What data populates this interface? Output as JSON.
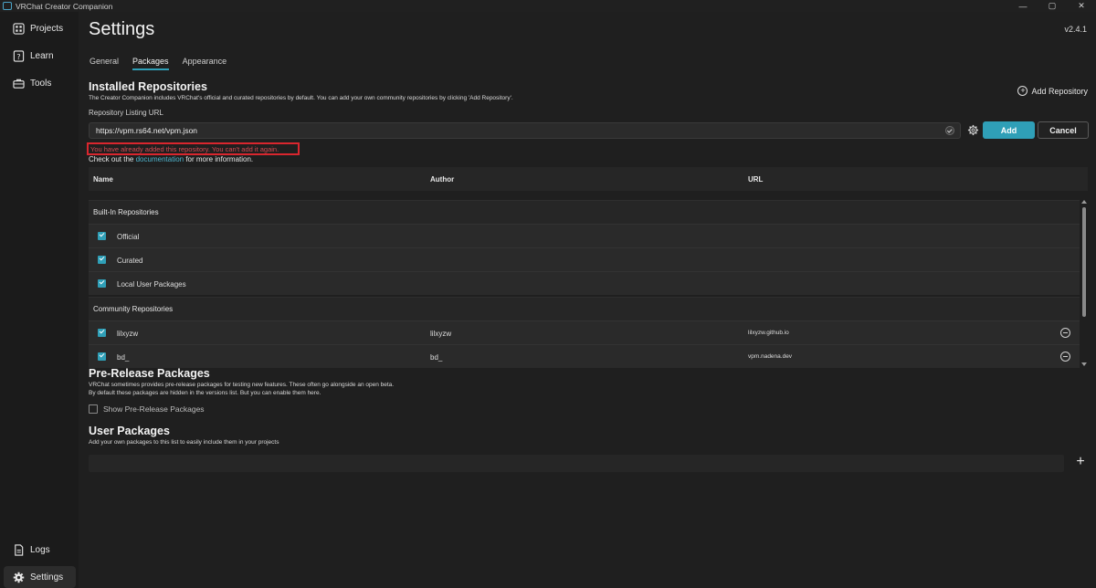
{
  "window": {
    "title": "VRChat Creator Companion"
  },
  "sidebar": {
    "items": [
      {
        "label": "Projects"
      },
      {
        "label": "Learn"
      },
      {
        "label": "Tools"
      }
    ],
    "bottom": [
      {
        "label": "Logs"
      },
      {
        "label": "Settings"
      }
    ]
  },
  "header": {
    "title": "Settings",
    "version": "v2.4.1"
  },
  "tabs": [
    {
      "label": "General"
    },
    {
      "label": "Packages"
    },
    {
      "label": "Appearance"
    }
  ],
  "repositories": {
    "title": "Installed Repositories",
    "description": "The Creator Companion includes VRChat's official and curated repositories by default. You can add your own community repositories by clicking 'Add Repository'.",
    "add_repository_label": "Add Repository",
    "url_label": "Repository Listing URL",
    "url_value": "https://vpm.rs64.net/vpm.json",
    "add_button": "Add",
    "cancel_button": "Cancel",
    "error": "You have already added this repository. You can't add it again.",
    "info_prefix": "Check out the",
    "info_link": "documentation",
    "info_suffix": "for more information.",
    "columns": {
      "name": "Name",
      "author": "Author",
      "url": "URL"
    },
    "builtin_group": "Built-In Repositories",
    "builtin": [
      {
        "name": "Official",
        "checked": true
      },
      {
        "name": "Curated",
        "checked": true
      },
      {
        "name": "Local User Packages",
        "checked": true
      }
    ],
    "community_group": "Community Repositories",
    "community": [
      {
        "name": "lilxyzw",
        "author": "lilxyzw",
        "url": "lilxyzw.github.io",
        "checked": true
      },
      {
        "name": "bd_",
        "author": "bd_",
        "url": "vpm.nadena.dev",
        "checked": true
      }
    ]
  },
  "prerelease": {
    "title": "Pre-Release Packages",
    "desc_line1": "VRChat sometimes provides pre-release packages for testing new features. These often go alongside an open beta.",
    "desc_line2": "By default these packages are hidden in the versions list. But you can enable them here.",
    "toggle_label": "Show Pre-Release Packages",
    "enabled": false
  },
  "user_packages": {
    "title": "User Packages",
    "description": "Add your own packages to this list to easily include them in your projects"
  },
  "colors": {
    "accent": "#2f9fb7",
    "error": "#d9262e",
    "background": "#1f1f1f"
  }
}
